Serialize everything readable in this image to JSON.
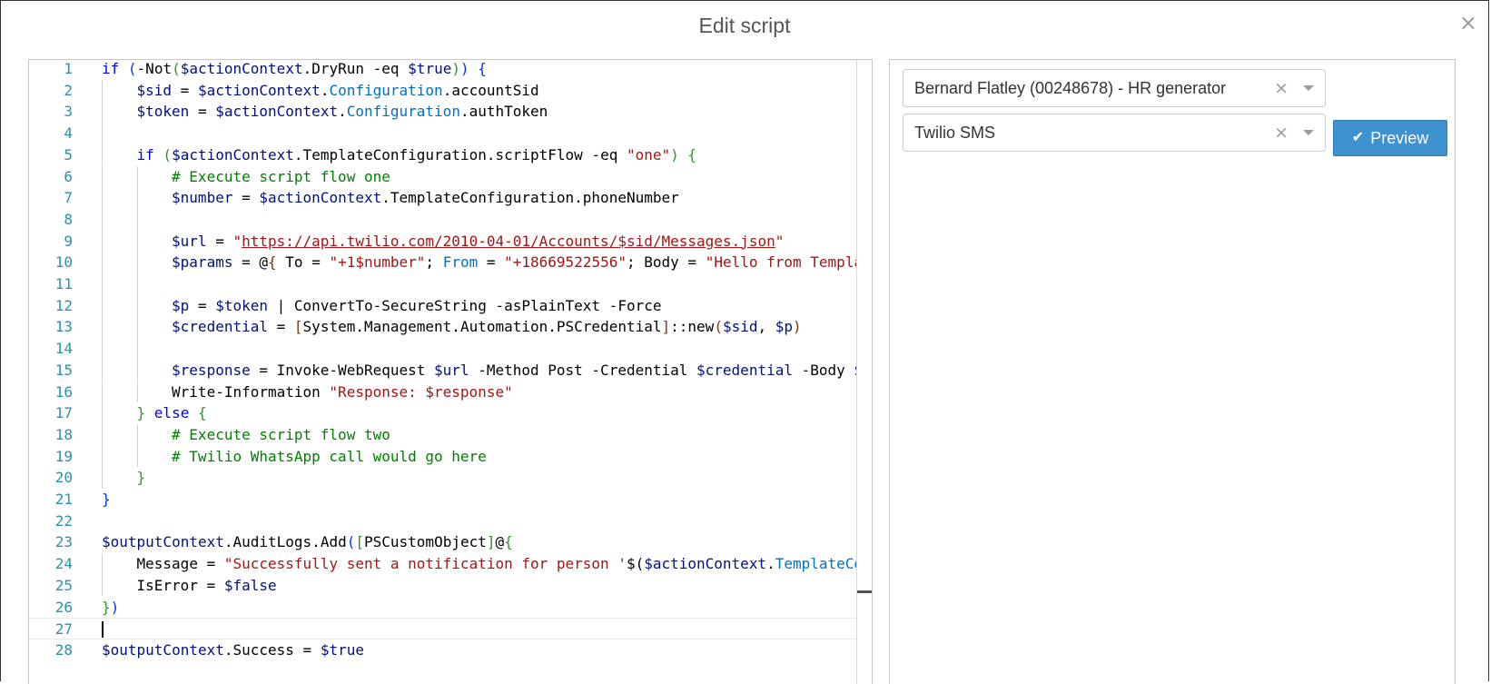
{
  "dialog": {
    "title": "Edit script",
    "close_glyph": "×"
  },
  "editor": {
    "current_line": 27,
    "lines": [
      {
        "n": "1",
        "indent": 0,
        "t": [
          [
            "kw",
            "if "
          ],
          [
            "br1",
            "("
          ],
          [
            "",
            "-Not"
          ],
          [
            "br2",
            "("
          ],
          [
            "var",
            "$actionContext"
          ],
          [
            "",
            ".DryRun -eq "
          ],
          [
            "var",
            "$true"
          ],
          [
            "br2",
            ")"
          ],
          [
            "br1",
            ")"
          ],
          [
            "",
            " "
          ],
          [
            "br1",
            "{"
          ]
        ]
      },
      {
        "n": "2",
        "indent": 1,
        "t": [
          [
            "var",
            "$sid"
          ],
          [
            "",
            " = "
          ],
          [
            "var",
            "$actionContext"
          ],
          [
            "",
            "."
          ],
          [
            "prop",
            "Configuration"
          ],
          [
            "",
            ".accountSid"
          ]
        ]
      },
      {
        "n": "3",
        "indent": 1,
        "t": [
          [
            "var",
            "$token"
          ],
          [
            "",
            " = "
          ],
          [
            "var",
            "$actionContext"
          ],
          [
            "",
            "."
          ],
          [
            "prop",
            "Configuration"
          ],
          [
            "",
            ".authToken"
          ]
        ]
      },
      {
        "n": "4",
        "indent": 1,
        "t": []
      },
      {
        "n": "5",
        "indent": 1,
        "t": [
          [
            "kw",
            "if "
          ],
          [
            "br2",
            "("
          ],
          [
            "var",
            "$actionContext"
          ],
          [
            "",
            ".TemplateConfiguration.scriptFlow -eq "
          ],
          [
            "str",
            "\"one\""
          ],
          [
            "br2",
            ")"
          ],
          [
            "",
            " "
          ],
          [
            "br2",
            "{"
          ]
        ]
      },
      {
        "n": "6",
        "indent": 2,
        "t": [
          [
            "cmt",
            "# Execute script flow one"
          ]
        ]
      },
      {
        "n": "7",
        "indent": 2,
        "t": [
          [
            "var",
            "$number"
          ],
          [
            "",
            " = "
          ],
          [
            "var",
            "$actionContext"
          ],
          [
            "",
            ".TemplateConfiguration.phoneNumber"
          ]
        ]
      },
      {
        "n": "8",
        "indent": 2,
        "t": []
      },
      {
        "n": "9",
        "indent": 2,
        "t": [
          [
            "var",
            "$url"
          ],
          [
            "",
            " = "
          ],
          [
            "str",
            "\""
          ],
          [
            "url",
            "https://api.twilio.com/2010-04-01/Accounts/$sid/Messages.json"
          ],
          [
            "str",
            "\""
          ]
        ]
      },
      {
        "n": "10",
        "indent": 2,
        "t": [
          [
            "var",
            "$params"
          ],
          [
            "",
            " = "
          ],
          [
            "",
            "@"
          ],
          [
            "br3",
            "{"
          ],
          [
            "",
            " To = "
          ],
          [
            "str",
            "\"+1$number\""
          ],
          [
            "",
            "; "
          ],
          [
            "prop",
            "From"
          ],
          [
            "",
            " = "
          ],
          [
            "str",
            "\"+18669522556\""
          ],
          [
            "",
            "; Body = "
          ],
          [
            "str",
            "\"Hello from Templat"
          ]
        ]
      },
      {
        "n": "11",
        "indent": 2,
        "t": []
      },
      {
        "n": "12",
        "indent": 2,
        "t": [
          [
            "var",
            "$p"
          ],
          [
            "",
            " = "
          ],
          [
            "var",
            "$token"
          ],
          [
            "",
            " | ConvertTo-SecureString -asPlainText -Force"
          ]
        ]
      },
      {
        "n": "13",
        "indent": 2,
        "t": [
          [
            "var",
            "$credential"
          ],
          [
            "",
            " = "
          ],
          [
            "br3",
            "["
          ],
          [
            "",
            "System.Management.Automation.PSCredential"
          ],
          [
            "br3",
            "]"
          ],
          [
            "",
            "::new"
          ],
          [
            "br3",
            "("
          ],
          [
            "var",
            "$sid"
          ],
          [
            "",
            ", "
          ],
          [
            "var",
            "$p"
          ],
          [
            "br3",
            ")"
          ]
        ]
      },
      {
        "n": "14",
        "indent": 2,
        "t": []
      },
      {
        "n": "15",
        "indent": 2,
        "t": [
          [
            "var",
            "$response"
          ],
          [
            "",
            " = Invoke-WebRequest "
          ],
          [
            "var",
            "$url"
          ],
          [
            "",
            " -Method Post -Credential "
          ],
          [
            "var",
            "$credential"
          ],
          [
            "",
            " -Body "
          ],
          [
            "var",
            "$p"
          ]
        ]
      },
      {
        "n": "16",
        "indent": 2,
        "t": [
          [
            "",
            "Write-Information "
          ],
          [
            "str",
            "\"Response: $response\""
          ]
        ]
      },
      {
        "n": "17",
        "indent": 1,
        "t": [
          [
            "br2",
            "}"
          ],
          [
            "",
            " "
          ],
          [
            "kw",
            "else"
          ],
          [
            "",
            " "
          ],
          [
            "br2",
            "{"
          ]
        ]
      },
      {
        "n": "18",
        "indent": 2,
        "t": [
          [
            "cmt",
            "# Execute script flow two"
          ]
        ]
      },
      {
        "n": "19",
        "indent": 2,
        "t": [
          [
            "cmt",
            "# Twilio WhatsApp call would go here"
          ]
        ]
      },
      {
        "n": "20",
        "indent": 1,
        "t": [
          [
            "br2",
            "}"
          ]
        ]
      },
      {
        "n": "21",
        "indent": 0,
        "t": [
          [
            "br1",
            "}"
          ]
        ]
      },
      {
        "n": "22",
        "indent": 0,
        "t": []
      },
      {
        "n": "23",
        "indent": 0,
        "t": [
          [
            "var",
            "$outputContext"
          ],
          [
            "",
            ".AuditLogs.Add"
          ],
          [
            "br1",
            "("
          ],
          [
            "br2",
            "["
          ],
          [
            "",
            "PSCustomObject"
          ],
          [
            "br2",
            "]"
          ],
          [
            "",
            "@"
          ],
          [
            "br2",
            "{"
          ]
        ]
      },
      {
        "n": "24",
        "indent": 1,
        "t": [
          [
            "",
            "Message = "
          ],
          [
            "str",
            "\"Successfully sent a notification for person '"
          ],
          [
            "",
            "$("
          ],
          [
            "var",
            "$actionContext"
          ],
          [
            "",
            "."
          ],
          [
            "prop",
            "TemplateCon"
          ]
        ]
      },
      {
        "n": "25",
        "indent": 1,
        "t": [
          [
            "",
            "IsError = "
          ],
          [
            "var",
            "$false"
          ]
        ]
      },
      {
        "n": "26",
        "indent": 0,
        "t": [
          [
            "br2",
            "}"
          ],
          [
            "br1",
            ")"
          ]
        ]
      },
      {
        "n": "27",
        "indent": 0,
        "t": []
      },
      {
        "n": "28",
        "indent": 0,
        "t": [
          [
            "var",
            "$outputContext"
          ],
          [
            "",
            ".Success = "
          ],
          [
            "var",
            "$true"
          ]
        ]
      }
    ]
  },
  "sidebar": {
    "person_select": {
      "value": "Bernard Flatley (00248678) - HR generator",
      "clear_glyph": "×"
    },
    "template_select": {
      "value": "Twilio SMS",
      "clear_glyph": "×"
    },
    "preview_button": {
      "label": "Preview",
      "icon": "✔"
    }
  },
  "colors": {
    "preview_button_bg": "#3f92d0",
    "line_number": "#2b91af",
    "keyword": "#0000ff",
    "string": "#a31515",
    "comment": "#008000"
  }
}
